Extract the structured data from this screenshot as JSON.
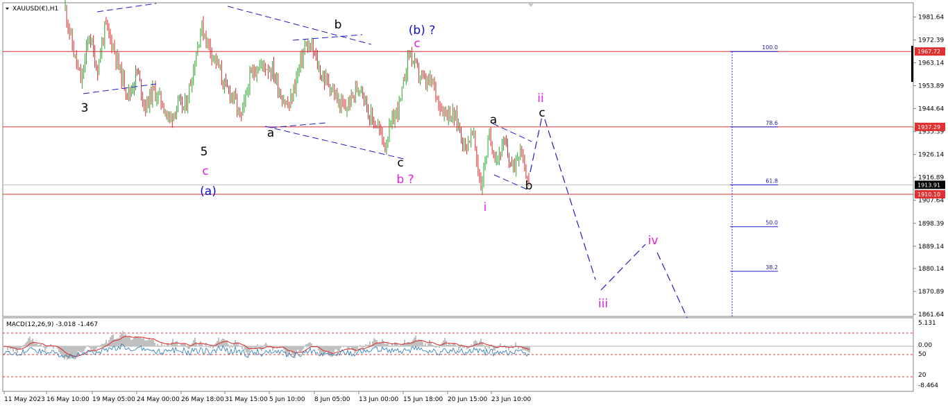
{
  "header": {
    "symbol": "XAUUSD(€),H1"
  },
  "colors": {
    "bull": "#2ca02c",
    "bear": "#d62728",
    "level": "#e03030",
    "wave_black": "#000000",
    "wave_magenta": "#e020e0",
    "wave_blue": "#1010cc",
    "projection": "#1a1acc",
    "macd_hist": "#c0c0c0",
    "macd_signal": "#d62728",
    "macd_line": "#1f77b4"
  },
  "price_axis": {
    "ticks": [
      "1981.64",
      "1972.39",
      "1963.14",
      "1953.89",
      "1944.64",
      "1935.39",
      "1926.14",
      "1916.89",
      "1907.64",
      "1898.39",
      "1889.14",
      "1880.14",
      "1870.89",
      "1861.64"
    ],
    "labels": [
      {
        "text": "1967.72",
        "value": 1967.72,
        "kind": "red"
      },
      {
        "text": "1937.29",
        "value": 1937.29,
        "kind": "red"
      },
      {
        "text": "1913.91",
        "value": 1913.91,
        "kind": "black"
      },
      {
        "text": "1910.10",
        "value": 1910.1,
        "kind": "red"
      }
    ]
  },
  "time_axis": {
    "labels": [
      "11 May 2023",
      "16 May 10:00",
      "19 May 05:00",
      "24 May 00:00",
      "26 May 18:00",
      "31 May 15:00",
      "5 Jun 10:00",
      "8 Jun 05:00",
      "13 Jun 00:00",
      "15 Jun 18:00",
      "20 Jun 15:00",
      "23 Jun 10:00"
    ]
  },
  "macd": {
    "label": "MACD(12,26,9) -3.018 -1.467",
    "axis_labels": [
      "5.131",
      "0.00",
      "50",
      "20",
      "-8.464"
    ]
  },
  "chart_data": {
    "type": "candlestick",
    "instrument": "XAUUSD(€)",
    "timeframe": "H1",
    "y_range": [
      1861.64,
      1985.0
    ],
    "horizontal_levels": [
      1967.72,
      1937.29,
      1910.1
    ],
    "current_price": 1913.91,
    "price_path": [
      1985,
      1968,
      1955,
      1975,
      1960,
      1978,
      1970,
      1958,
      1950,
      1960,
      1945,
      1952,
      1948,
      1940,
      1946,
      1945,
      1960,
      1978,
      1970,
      1963,
      1953,
      1950,
      1940,
      1956,
      1962,
      1962,
      1960,
      1950,
      1945,
      1958,
      1970,
      1968,
      1958,
      1955,
      1948,
      1944,
      1950,
      1955,
      1942,
      1938,
      1930,
      1940,
      1948,
      1968,
      1960,
      1955,
      1955,
      1945,
      1943,
      1940,
      1929,
      1935,
      1913,
      1933,
      1925,
      1930,
      1920,
      1930,
      1913
    ],
    "fibonacci": [
      {
        "level": "100.0",
        "price": 1967.72
      },
      {
        "level": "78.6",
        "price": 1937.29
      },
      {
        "level": "61.8",
        "price": 1913.91
      },
      {
        "level": "50.0",
        "price": 1897.0
      },
      {
        "level": "38.2",
        "price": 1879.0
      }
    ],
    "wave_labels": [
      {
        "text": "3",
        "color": "black"
      },
      {
        "text": "5",
        "color": "black"
      },
      {
        "text": "c",
        "color": "magenta"
      },
      {
        "text": "(a)",
        "color": "blue"
      },
      {
        "text": "a",
        "color": "black"
      },
      {
        "text": "b",
        "color": "black"
      },
      {
        "text": "c",
        "color": "black"
      },
      {
        "text": "b ?",
        "color": "magenta"
      },
      {
        "text": "(b) ?",
        "color": "blue"
      },
      {
        "text": "c",
        "color": "magenta"
      },
      {
        "text": "i",
        "color": "magenta"
      },
      {
        "text": "a",
        "color": "black"
      },
      {
        "text": "b",
        "color": "black"
      },
      {
        "text": "c",
        "color": "black"
      },
      {
        "text": "ii",
        "color": "magenta"
      },
      {
        "text": "iii",
        "color": "magenta"
      },
      {
        "text": "iv",
        "color": "magenta"
      }
    ]
  }
}
